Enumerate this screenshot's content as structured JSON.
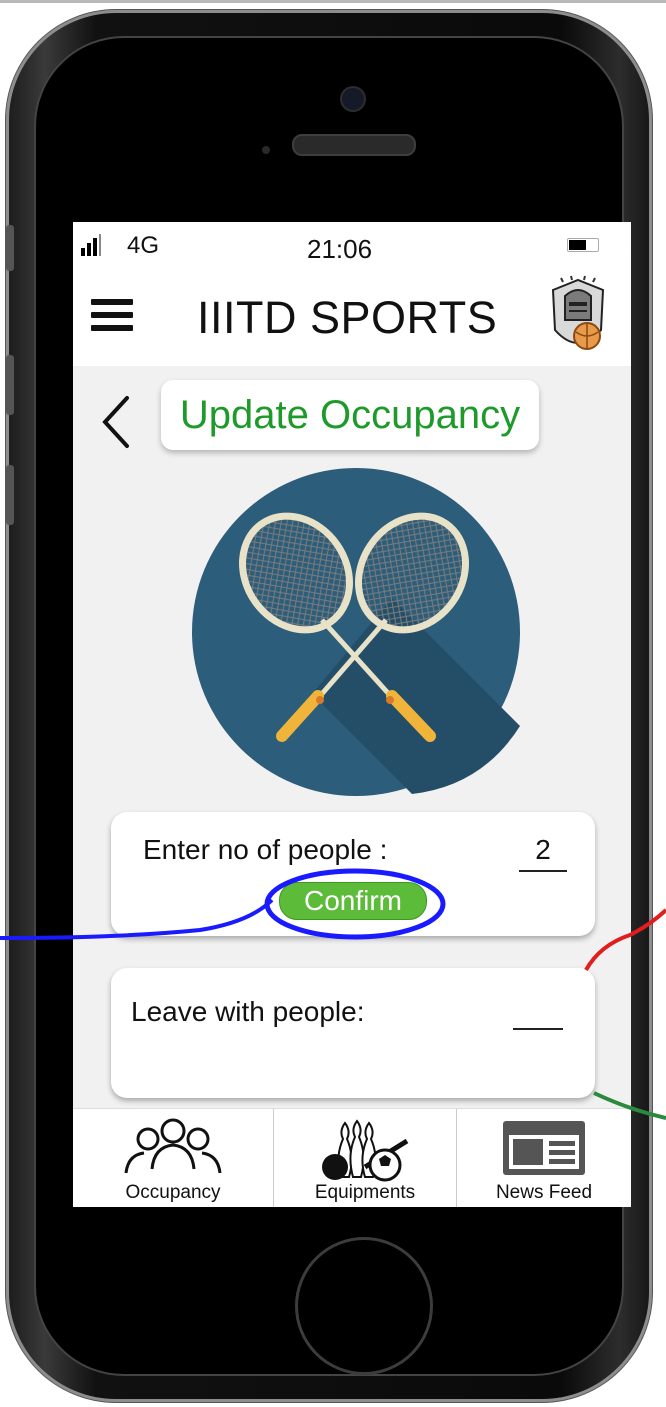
{
  "status_bar": {
    "network": "4G",
    "time": "21:06"
  },
  "header": {
    "title": "IIITD SPORTS"
  },
  "page": {
    "title": "Update Occupancy"
  },
  "form": {
    "people_label": "Enter no of people :",
    "people_value": "2",
    "confirm_label": "Confirm",
    "leave_label": "Leave with people:",
    "leave_value": ""
  },
  "bottom_nav": [
    {
      "label": "Occupancy",
      "icon": "people-icon"
    },
    {
      "label": "Equipments",
      "icon": "equipment-icon"
    },
    {
      "label": "News Feed",
      "icon": "newspaper-icon"
    }
  ],
  "colors": {
    "title_green": "#1e9a2a",
    "confirm_green": "#5dbb3a",
    "sport_circle": "#2c5d7a",
    "annotation_blue": "#1a1aff",
    "annotation_red": "#e01e1e",
    "annotation_green": "#2b8a3e"
  }
}
